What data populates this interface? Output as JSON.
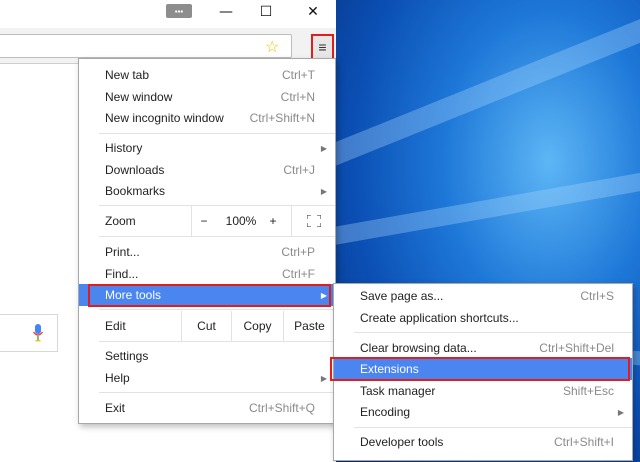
{
  "window": {
    "minimize_icon": "minimize-icon",
    "maximize_icon": "maximize-icon",
    "close_icon": "close-icon"
  },
  "toolbar": {
    "bookmark_icon": "star-icon",
    "menu_icon": "hamburger-menu-icon"
  },
  "main_menu": {
    "new_tab": {
      "label": "New tab",
      "shortcut": "Ctrl+T"
    },
    "new_window": {
      "label": "New window",
      "shortcut": "Ctrl+N"
    },
    "new_incognito": {
      "label": "New incognito window",
      "shortcut": "Ctrl+Shift+N"
    },
    "history": {
      "label": "History"
    },
    "downloads": {
      "label": "Downloads",
      "shortcut": "Ctrl+J"
    },
    "bookmarks": {
      "label": "Bookmarks"
    },
    "zoom": {
      "label": "Zoom",
      "minus": "−",
      "value": "100%",
      "plus": "+"
    },
    "print": {
      "label": "Print...",
      "shortcut": "Ctrl+P"
    },
    "find": {
      "label": "Find...",
      "shortcut": "Ctrl+F"
    },
    "more_tools": {
      "label": "More tools"
    },
    "edit": {
      "label": "Edit",
      "cut": "Cut",
      "copy": "Copy",
      "paste": "Paste"
    },
    "settings": {
      "label": "Settings"
    },
    "help": {
      "label": "Help"
    },
    "exit": {
      "label": "Exit",
      "shortcut": "Ctrl+Shift+Q"
    }
  },
  "more_tools_menu": {
    "save_page": {
      "label": "Save page as...",
      "shortcut": "Ctrl+S"
    },
    "create_shortcuts": {
      "label": "Create application shortcuts..."
    },
    "clear_browsing": {
      "label": "Clear browsing data...",
      "shortcut": "Ctrl+Shift+Del"
    },
    "extensions": {
      "label": "Extensions"
    },
    "task_manager": {
      "label": "Task manager",
      "shortcut": "Shift+Esc"
    },
    "encoding": {
      "label": "Encoding"
    },
    "developer_tools": {
      "label": "Developer tools",
      "shortcut": "Ctrl+Shift+I"
    }
  },
  "colors": {
    "highlight": "#4a85f0",
    "callout": "#e01e1e"
  }
}
